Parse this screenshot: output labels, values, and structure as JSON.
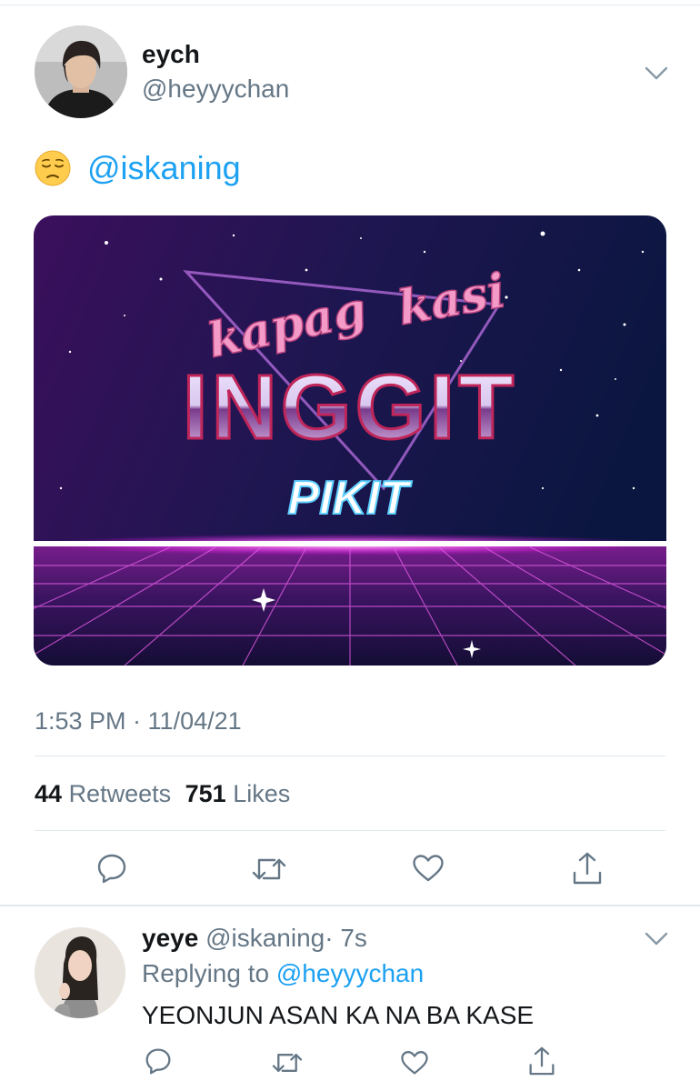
{
  "tweet": {
    "author_name": "eych",
    "author_handle": "@heyyychan",
    "emoji_name": "pensive-face-icon",
    "mention": "@iskaning",
    "image": {
      "line1_left": "kapag",
      "line1_right": "kasi",
      "big_word": "INGGIT",
      "sub_word": "PIKIT"
    },
    "timestamp": "1:53 PM · 11/04/21",
    "retweets_count": "44",
    "retweets_label": "Retweets",
    "likes_count": "751",
    "likes_label": "Likes"
  },
  "reply": {
    "author_name": "yeye",
    "author_handle": "@iskaning",
    "time": "· 7s",
    "replying_prefix": "Replying to",
    "replying_to": "@heyyychan",
    "text": "YEONJUN ASAN KA NA BA KASE"
  },
  "icons": {
    "reply": "comment-icon",
    "retweet": "retweet-icon",
    "like": "heart-icon",
    "share": "share-icon",
    "caret": "chevron-down-icon"
  },
  "colors": {
    "accent": "#1da1f2",
    "muted": "#657786",
    "divider": "#e1e8ed",
    "text": "#14171a"
  }
}
